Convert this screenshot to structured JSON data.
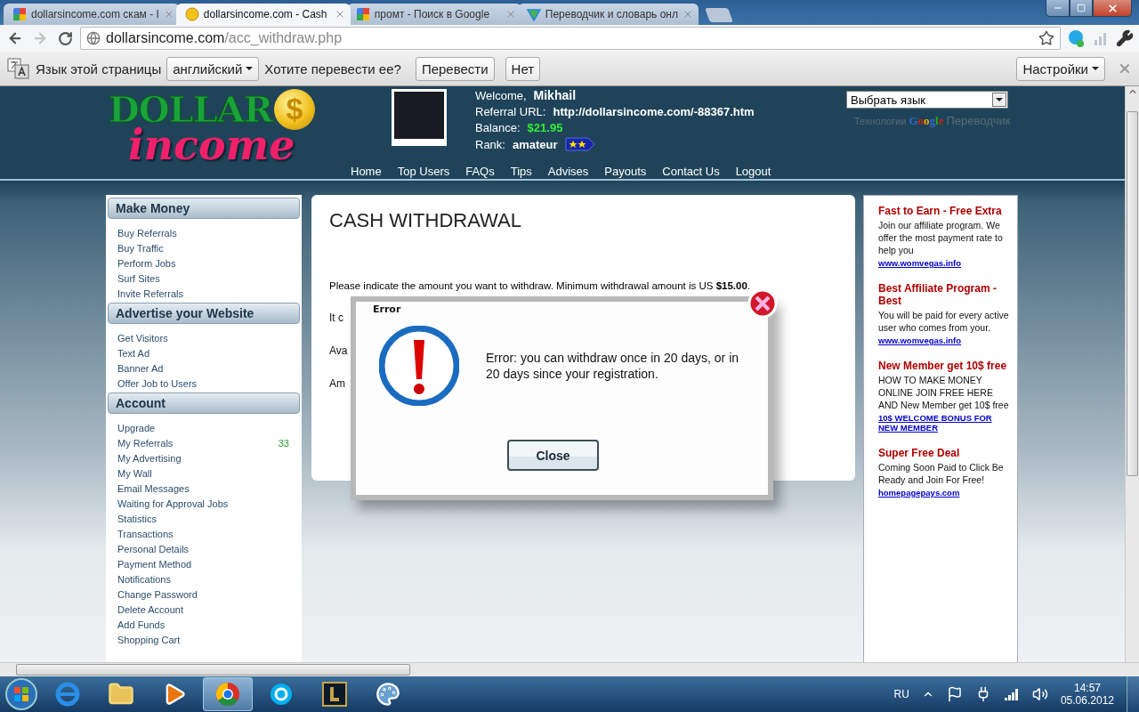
{
  "browser": {
    "tabs": [
      {
        "title": "dollarsincome.com скам - I",
        "kind": "g",
        "selected": false
      },
      {
        "title": "dollarsincome.com - Cash",
        "kind": "coin",
        "selected": true
      },
      {
        "title": "промт - Поиск в Google",
        "kind": "g",
        "selected": false
      },
      {
        "title": "Переводчик и словарь онл",
        "kind": "tri",
        "selected": false
      }
    ],
    "back_disabled": false,
    "forward_disabled": true,
    "url_host": "dollarsincome.com",
    "url_path": "/acc_withdraw.php"
  },
  "translate_bar": {
    "label": "Язык этой страницы",
    "language": "английский",
    "question": "Хотите перевести ее?",
    "buttons": [
      "Перевести",
      "Нет"
    ],
    "options": "Настройки"
  },
  "header": {
    "logo_top": "DOLLAR",
    "logo_coin": "$",
    "logo_bottom": "income",
    "welcome_label": "Welcome, ",
    "user": "Mikhail",
    "referral_label": "Referral URL: ",
    "referral_url": "http://dollarsincome.com/-88367.htm",
    "balance_label": "Balance: ",
    "balance": "$21.95",
    "rank_label": "Rank: ",
    "rank": "amateur",
    "nav": [
      "Home",
      "Top Users",
      "FAQs",
      "Tips",
      "Advises",
      "Payouts",
      "Contact Us",
      "Logout"
    ],
    "language_select": "Выбрать язык",
    "powered_by": "Технологии",
    "powered_brand": "Google",
    "powered_product": "Переводчик"
  },
  "sidebar": [
    {
      "title": "Make Money",
      "items": [
        {
          "label": "Buy Referrals"
        },
        {
          "label": "Buy Traffic"
        },
        {
          "label": "Perform Jobs"
        },
        {
          "label": "Surf Sites"
        },
        {
          "label": "Invite Referrals"
        }
      ]
    },
    {
      "title": "Advertise your Website",
      "items": [
        {
          "label": "Get Visitors"
        },
        {
          "label": "Text Ad"
        },
        {
          "label": "Banner Ad"
        },
        {
          "label": "Offer Job to Users"
        }
      ]
    },
    {
      "title": "Account",
      "items": [
        {
          "label": "Upgrade"
        },
        {
          "label": "My Referrals",
          "count": "33"
        },
        {
          "label": "My Advertising"
        },
        {
          "label": "My Wall"
        },
        {
          "label": "Email Messages"
        },
        {
          "label": "Waiting for Approval Jobs"
        },
        {
          "label": "Statistics"
        },
        {
          "label": "Transactions"
        },
        {
          "label": "Personal Details"
        },
        {
          "label": "Payment Method"
        },
        {
          "label": "Notifications"
        },
        {
          "label": "Change Password"
        },
        {
          "label": "Delete Account"
        },
        {
          "label": "Add Funds"
        },
        {
          "label": "Shopping Cart"
        }
      ]
    }
  ],
  "main": {
    "title": "CASH WITHDRAWAL",
    "notice": "Please indicate the amount you want to withdraw. Minimum withdrawal amount is US **$15.00**.",
    "transfer_note": "It c",
    "funds_label": "Ava",
    "amount_label": "Am"
  },
  "ads": [
    {
      "title": "Fast to Earn - Free Extra",
      "text": "Join our affiliate program. We offer the most payment rate to help you",
      "link": "www.womvegas.info"
    },
    {
      "title": "Best Affiliate Program - Best",
      "text": "You will be paid for every active user who comes from your.",
      "link": "www.womvegas.info"
    },
    {
      "title": "New Member get 10$ free",
      "text": "HOW TO MAKE MONEY ONLINE JOIN FREE HERE AND New Member get 10$ free",
      "link": "10$ WELCOME BONUS FOR NEW MEMBER"
    },
    {
      "title": "Super Free Deal",
      "text": "Coming Soon Paid to Click Be Ready and Join For Free!",
      "link": "homepagepays.com"
    }
  ],
  "dialog": {
    "title": "Error",
    "message": "Error: you can withdraw once in 20 days, or in 20 days since your registration.",
    "button": "Close"
  },
  "taskbar": {
    "apps": [
      {
        "kind": "ie",
        "selected": false
      },
      {
        "kind": "folder",
        "selected": false
      },
      {
        "kind": "media",
        "selected": false
      },
      {
        "kind": "chrome",
        "selected": true
      },
      {
        "kind": "skype",
        "selected": false
      },
      {
        "kind": "game",
        "selected": false
      },
      {
        "kind": "paint",
        "selected": false
      }
    ],
    "language": "RU",
    "time": "14:57",
    "date": "05.06.2012"
  }
}
